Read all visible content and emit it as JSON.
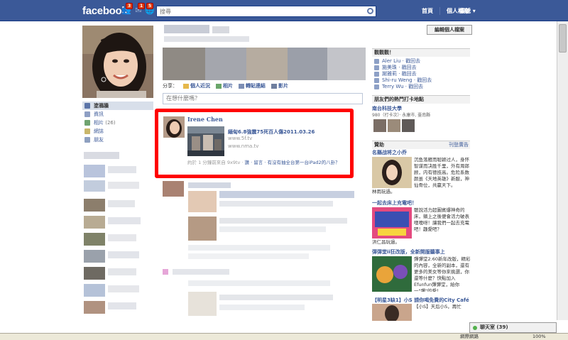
{
  "topbar": {
    "logo": "facebook",
    "search_placeholder": "搜尋",
    "badges": [
      "3",
      "1",
      "5"
    ],
    "links": [
      "首頁",
      "個人檔案"
    ],
    "account": "帳號 ▾",
    "colors": {
      "bar": "#3b5998",
      "badge": "#dd3c10"
    }
  },
  "left_nav": {
    "items": [
      {
        "label": "塗鴉牆",
        "icon": "wall-icon"
      },
      {
        "label": "資訊",
        "icon": "info-icon"
      },
      {
        "label": "相片",
        "count": "(26)",
        "icon": "photos-icon"
      },
      {
        "label": "網誌",
        "icon": "notes-icon"
      },
      {
        "label": "朋友",
        "icon": "friends-icon"
      }
    ]
  },
  "profile": {
    "edit_button": "編輯個人檔案"
  },
  "share": {
    "label": "分享：",
    "buttons": [
      "個人近況",
      "相片",
      "轉貼連結",
      "影片"
    ],
    "input_placeholder": "在想什麼嗎？"
  },
  "post": {
    "author": "Irene Chen",
    "title": "緬甸6.8強震75死百人傷2011.03.26",
    "source1": "www.5f.tv",
    "source2": "www.nma.tv",
    "meta_prefix": "約於 1 分鐘前來自 9x9tv · ",
    "meta_links": "讚 · 留言 · 有沒有抽全台第一台iPad2的八卦？"
  },
  "right": {
    "watch_title": "觀觀觀！",
    "watch_items": [
      "Aler Liu · 戳回去",
      "施美珠 · 戳回去",
      "謝雅莉 · 戳回去",
      "Shi-ru Weng · 戳回去",
      "Terry Wu · 戳回去"
    ],
    "checkin_title": "朋友們的熱門打卡地點",
    "checkin_place": "南台科技大學",
    "checkin_detail": "980（打卡次）· 永康市, 臺南縣",
    "sponsor_title": "贊助",
    "sponsor_link": "刊登廣告",
    "ads": [
      {
        "title": "名縣战将之小乔",
        "text": "沉鱼落雁而聪颖过人，身怀智谋而决胜千里，外有周郎顾，内有德技高。危险系数颜虽《天地英雄》新服，神仙骨位，共赢天下。",
        "foot": "林雨玩過。"
      },
      {
        "title": "一起去床上充電吧！",
        "text": "聽說活力超圖賓爆神奇的床，躺上之後便會活力破表噢噢呀！讓我們一起去充電吧！趣愛吧？",
        "foot": "洪仁昌玩過。"
      },
      {
        "title": "彈彈堂ii狂改版，全新開服聽事上",
        "text": "彈彈堂2.60新年改版，精彩 的內容，全新的副本，還有 更多的美女等你來挑選，你還等什麼？快點加入Efunfun彈彈堂，給你一\"彈\"的愛！",
        "foot": ""
      },
      {
        "title": "【明星3缺1】小S 請你喝免費的City Café",
        "text": "【小S】天后小S，再忙",
        "foot": "謝琳宜"
      }
    ]
  },
  "chat": {
    "label": "聊天室 (39)"
  },
  "statusbar": {
    "network": "網際網路",
    "zoom": "100%"
  }
}
